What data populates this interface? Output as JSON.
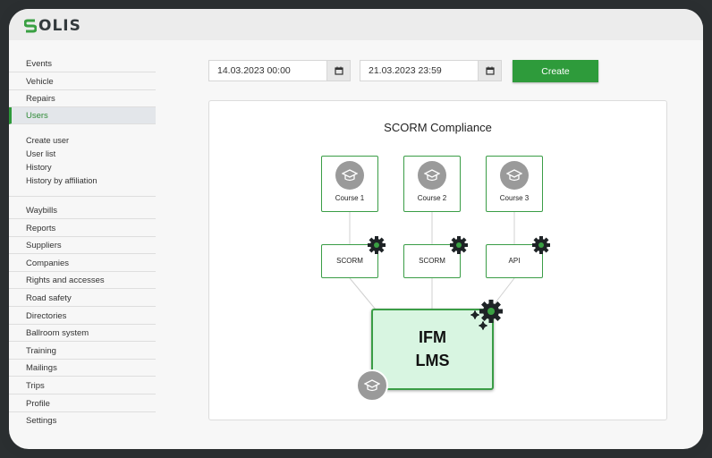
{
  "app": {
    "logo_text": "OLIS",
    "logo_letter": "S"
  },
  "sidebar": {
    "items_top": [
      {
        "label": "Events"
      },
      {
        "label": "Vehicle"
      },
      {
        "label": "Repairs"
      },
      {
        "label": "Users"
      }
    ],
    "sub_items": [
      {
        "label": "Create user"
      },
      {
        "label": "User list"
      },
      {
        "label": "History"
      },
      {
        "label": "History by affiliation"
      }
    ],
    "items_bottom": [
      {
        "label": "Waybills"
      },
      {
        "label": "Reports"
      },
      {
        "label": "Suppliers"
      },
      {
        "label": "Companies"
      },
      {
        "label": "Rights and accesses"
      },
      {
        "label": "Road safety"
      },
      {
        "label": "Directories"
      },
      {
        "label": "Ballroom system"
      },
      {
        "label": "Training"
      },
      {
        "label": "Mailings"
      },
      {
        "label": "Trips"
      },
      {
        "label": "Profile"
      },
      {
        "label": "Settings"
      }
    ]
  },
  "filters": {
    "date_from": "14.03.2023 00:00",
    "date_to": "21.03.2023 23:59",
    "create_label": "Create"
  },
  "diagram": {
    "title": "SCORM Compliance",
    "courses": [
      {
        "label": "Course 1"
      },
      {
        "label": "Course 2"
      },
      {
        "label": "Course 3"
      }
    ],
    "connectors": [
      {
        "label": "SCORM"
      },
      {
        "label": "SCORM"
      },
      {
        "label": "API"
      }
    ],
    "lms_line1": "IFM",
    "lms_line2": "LMS"
  },
  "colors": {
    "accent": "#2e9b3b",
    "lms_fill": "#d8f5e1"
  },
  "icons": {
    "course": "graduation-cap-icon",
    "connector": "gear-icon",
    "calendar": "calendar-icon"
  }
}
